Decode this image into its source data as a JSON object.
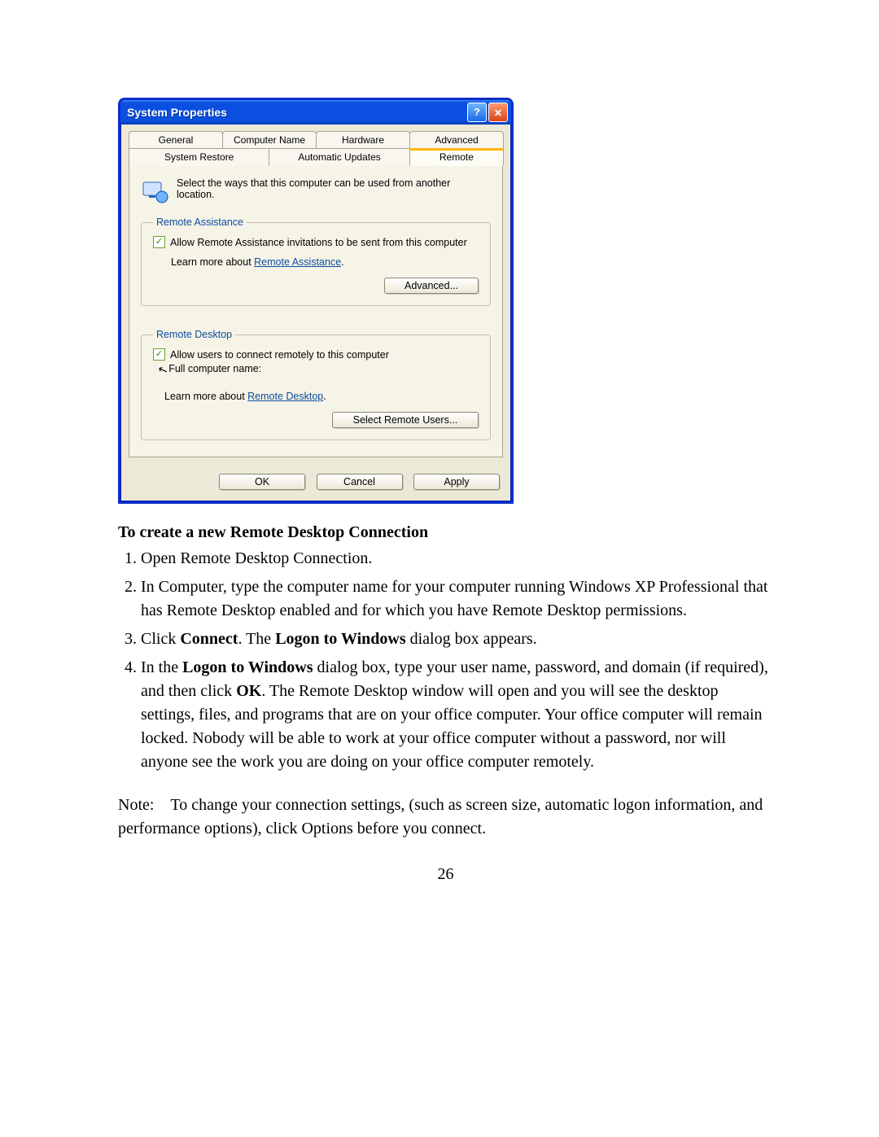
{
  "dialog": {
    "title": "System Properties",
    "tabs_row1": [
      "General",
      "Computer Name",
      "Hardware",
      "Advanced"
    ],
    "tabs_row2": [
      "System Restore",
      "Automatic Updates",
      "Remote"
    ],
    "active_tab": "Remote",
    "intro_text": "Select the ways that this computer can be used from another location.",
    "ra": {
      "legend": "Remote Assistance",
      "checkbox_label": "Allow Remote Assistance invitations to be sent from this computer",
      "learn_prefix": "Learn more about ",
      "learn_link": "Remote Assistance",
      "learn_suffix": ".",
      "advanced_btn": "Advanced..."
    },
    "rd": {
      "legend": "Remote Desktop",
      "checkbox_label": "Allow users to connect remotely to this computer",
      "full_name_label": "Full computer name:",
      "learn_prefix": "Learn more about ",
      "learn_link": "Remote Desktop",
      "learn_suffix": ".",
      "select_btn": "Select Remote Users..."
    },
    "buttons": {
      "ok": "OK",
      "cancel": "Cancel",
      "apply": "Apply"
    }
  },
  "doc": {
    "heading": "To create a new Remote Desktop Connection",
    "step1": "Open Remote Desktop Connection.",
    "step2": "In Computer, type the computer name for your computer running Windows XP Professional that has Remote Desktop enabled and for which you have Remote Desktop permissions.",
    "step3_a": "Click ",
    "step3_b": "Connect",
    "step3_c": ". The ",
    "step3_d": "Logon to Windows",
    "step3_e": " dialog box appears.",
    "step4_a": "In the ",
    "step4_b": "Logon to Windows",
    "step4_c": " dialog box, type your user name, password, and domain (if required), and then click ",
    "step4_d": "OK",
    "step4_e": ". The Remote Desktop window will open and you will see the desktop settings, files, and programs that are on your office computer. Your office computer will remain locked. Nobody will be able to work at your office computer without a password, nor will anyone see the work you are doing on your office computer remotely.",
    "note": "Note: To change your connection settings, (such as screen size, automatic logon information, and performance options), click Options before you connect.",
    "page_number": "26"
  }
}
